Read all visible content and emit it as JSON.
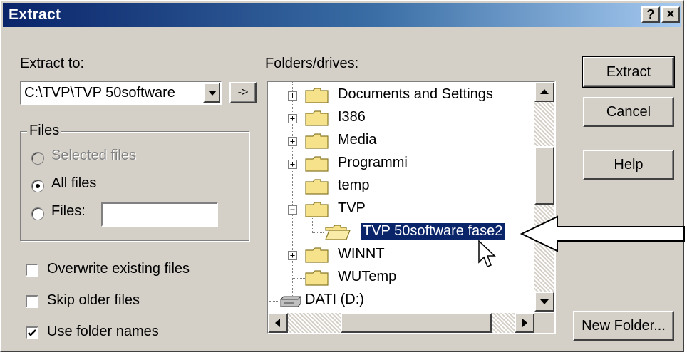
{
  "window": {
    "title": "Extract",
    "help_button": "?",
    "close_button": "×"
  },
  "extract_to": {
    "label": "Extract to:",
    "path_value": "C:\\TVP\\TVP 50software",
    "go_button": "->"
  },
  "files_group": {
    "title": "Files",
    "options": [
      {
        "label": "Selected files",
        "enabled": false,
        "selected": false
      },
      {
        "label": "All files",
        "enabled": true,
        "selected": true
      },
      {
        "label": "Files:",
        "enabled": true,
        "selected": false
      }
    ],
    "files_input_value": ""
  },
  "checkboxes": [
    {
      "label": "Overwrite existing files",
      "checked": false
    },
    {
      "label": "Skip older files",
      "checked": false
    },
    {
      "label": "Use folder names",
      "checked": true
    }
  ],
  "folders": {
    "label": "Folders/drives:",
    "items": [
      {
        "label": "Documents and Settings",
        "expander": "+",
        "icon": "folder-icon"
      },
      {
        "label": "I386",
        "expander": "+",
        "icon": "folder-icon"
      },
      {
        "label": "Media",
        "expander": "+",
        "icon": "folder-icon"
      },
      {
        "label": "Programmi",
        "expander": "+",
        "icon": "folder-icon"
      },
      {
        "label": "temp",
        "expander": "",
        "icon": "folder-icon"
      },
      {
        "label": "TVP",
        "expander": "−",
        "icon": "folder-icon"
      },
      {
        "label": "TVP 50software fase2",
        "expander": "",
        "icon": "open-folder-icon",
        "selected": true
      },
      {
        "label": "WINNT",
        "expander": "+",
        "icon": "folder-icon"
      },
      {
        "label": "WUTemp",
        "expander": "",
        "icon": "folder-icon"
      },
      {
        "label": "DATI (D:)",
        "expander": "",
        "icon": "drive-icon"
      }
    ]
  },
  "buttons": {
    "extract": "Extract",
    "cancel": "Cancel",
    "help": "Help",
    "new_folder": "New Folder..."
  },
  "colors": {
    "face": "#d4d0c8",
    "title_start": "#0a246a",
    "title_end": "#a6caf0",
    "selection": "#0a246a",
    "folder": "#f5e28a"
  }
}
